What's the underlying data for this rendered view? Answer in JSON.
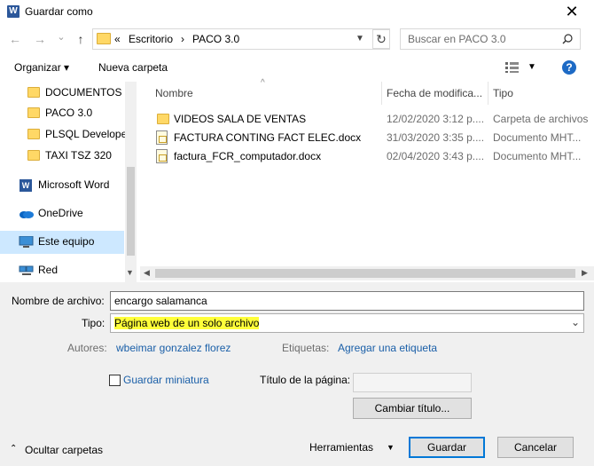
{
  "window": {
    "title": "Guardar como",
    "close": "✕"
  },
  "nav": {
    "back": "←",
    "forward": "→",
    "dropdown": "⌄",
    "up": "↑"
  },
  "address": {
    "overflow": "«",
    "crumbs": [
      "Escritorio",
      "PACO 3.0"
    ],
    "separator": "›"
  },
  "search": {
    "placeholder": "Buscar en PACO 3.0"
  },
  "toolbar": {
    "organize": "Organizar ▾",
    "new_folder": "Nueva carpeta",
    "help": "?"
  },
  "sidebar": {
    "items": [
      {
        "label": "DOCUMENTOS PAC",
        "icon": "folder-icon"
      },
      {
        "label": "PACO 3.0",
        "icon": "folder-icon"
      },
      {
        "label": "PLSQL Developer",
        "icon": "folder-icon"
      },
      {
        "label": "TAXI TSZ 320",
        "icon": "folder-icon"
      },
      {
        "label": "Microsoft Word",
        "icon": "word-icon"
      },
      {
        "label": "OneDrive",
        "icon": "cloud-icon"
      },
      {
        "label": "Este equipo",
        "icon": "pc-icon"
      },
      {
        "label": "Red",
        "icon": "network-icon"
      }
    ]
  },
  "columns": {
    "name": "Nombre",
    "date": "Fecha de modifica...",
    "type": "Tipo"
  },
  "files": [
    {
      "name": "VIDEOS SALA DE VENTAS",
      "date": "12/02/2020 3:12 p....",
      "type": "Carpeta de archivos",
      "icon": "folder-icon"
    },
    {
      "name": "FACTURA CONTING FACT ELEC.docx",
      "date": "31/03/2020 3:35 p....",
      "type": "Documento MHT...",
      "icon": "document-icon"
    },
    {
      "name": "factura_FCR_computador.docx",
      "date": "02/04/2020 3:43 p....",
      "type": "Documento MHT...",
      "icon": "document-icon"
    }
  ],
  "form": {
    "filename_label": "Nombre de archivo:",
    "filename_value": "encargo salamanca",
    "type_label": "Tipo:",
    "type_value": "Página web de un solo archivo",
    "authors_label": "Autores:",
    "authors_value": "wbeimar gonzalez florez",
    "tags_label": "Etiquetas:",
    "tags_value": "Agregar una etiqueta",
    "thumbnail_label": "Guardar miniatura",
    "page_title_label": "Título de la página:",
    "page_title_value": "",
    "change_title_button": "Cambiar título..."
  },
  "footer": {
    "hide_folders": "Ocultar carpetas",
    "tools": "Herramientas",
    "save": "Guardar",
    "cancel": "Cancelar"
  },
  "colors": {
    "accent": "#0078d7",
    "selected": "#cde8ff",
    "highlight": "#ffff3a",
    "link": "#1a5fa8"
  }
}
